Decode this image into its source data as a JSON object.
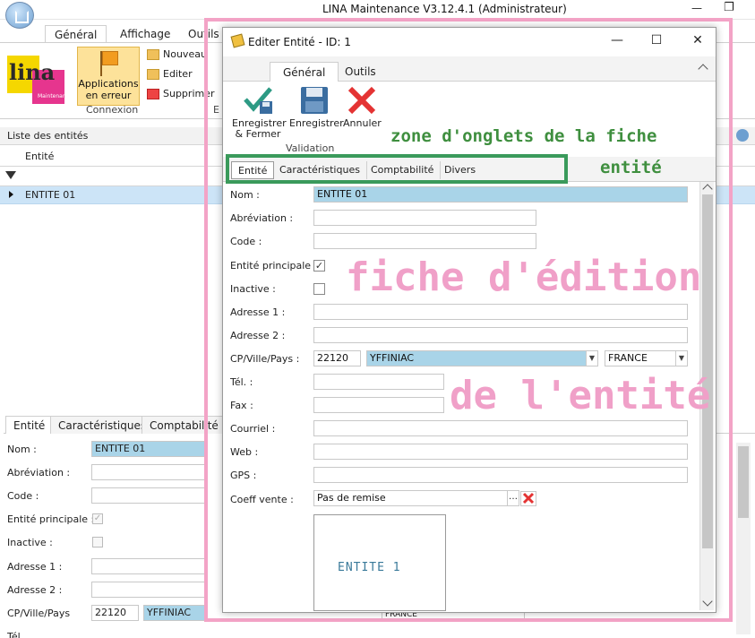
{
  "app": {
    "title": "LINA Maintenance  V3.12.4.1  (Administrateur)"
  },
  "main_ribbon": {
    "tabs": [
      "Général",
      "Affichage",
      "Outils"
    ],
    "logo": "lina",
    "logo_sub": "Maintenance",
    "app_error_button": "Applications en erreur",
    "connexion_label": "Connexion",
    "nouveau": "Nouveau",
    "editer": "Editer",
    "supprimer": "Supprimer",
    "group_initial": "E"
  },
  "entity_list": {
    "header": "Liste des entités",
    "column": "Entité",
    "rows": [
      "ENTITE 01"
    ]
  },
  "detail_panel": {
    "tabs": [
      "Entité",
      "Caractéristiques",
      "Comptabilité"
    ],
    "labels": {
      "nom": "Nom :",
      "abreviation": "Abréviation :",
      "code": "Code :",
      "entite_principale": "Entité principale :",
      "inactive": "Inactive :",
      "adresse1": "Adresse 1 :",
      "adresse2": "Adresse 2 :",
      "cp_ville": "CP/Ville/Pays",
      "tel": "Tél."
    },
    "values": {
      "nom": "ENTITE 01",
      "cp": "22120",
      "ville": "YFFINIAC",
      "pays": "FRANCE"
    }
  },
  "dialog": {
    "title": "Editer Entité - ID: 1",
    "ribbon_tabs": [
      "Général",
      "Outils"
    ],
    "buttons": {
      "save_close": "Enregistrer & Fermer",
      "save": "Enregistrer",
      "cancel": "Annuler"
    },
    "validation_label": "Validation",
    "form_tabs": [
      "Entité",
      "Caractéristiques",
      "Comptabilité",
      "Divers"
    ],
    "labels": {
      "nom": "Nom :",
      "abreviation": "Abréviation :",
      "code": "Code :",
      "entite_principale": "Entité principale :",
      "inactive": "Inactive :",
      "adresse1": "Adresse 1 :",
      "adresse2": "Adresse 2 :",
      "cp_ville": "CP/Ville/Pays :",
      "tel": "Tél. :",
      "fax": "Fax :",
      "courriel": "Courriel :",
      "web": "Web :",
      "gps": "GPS :",
      "coeff_vente": "Coeff vente :"
    },
    "values": {
      "nom": "ENTITE 01",
      "cp": "22120",
      "ville": "YFFINIAC",
      "pays": "FRANCE",
      "coeff_vente": "Pas de remise",
      "entite_principale_checked": true,
      "inactive_checked": false
    },
    "photo_text": "ENTITE 1"
  },
  "annotations": {
    "zone_onglets_1": "zone d'onglets de la fiche",
    "zone_onglets_2": "entité",
    "fiche_1": "fiche d'édition",
    "fiche_2": "de l'entité"
  },
  "colors": {
    "highlight_field": "#a9d4e8",
    "pink_annotation": "#f3a3c6",
    "green_annotation": "#3a9a5b"
  }
}
